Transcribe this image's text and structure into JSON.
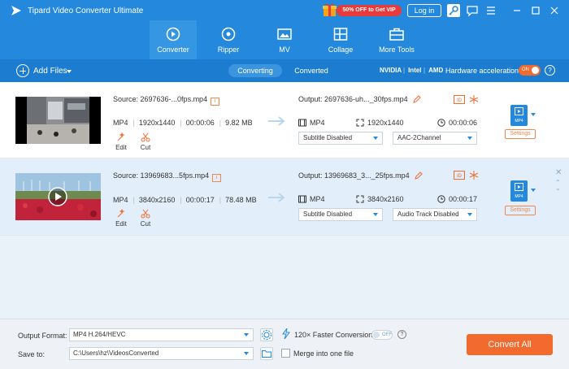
{
  "app": {
    "title": "Tipard Video Converter Ultimate",
    "promo": "50% OFF to Get VIP",
    "login": "Log in"
  },
  "tabs": [
    {
      "label": "Converter",
      "icon": "converter-icon",
      "active": true
    },
    {
      "label": "Ripper",
      "icon": "ripper-icon"
    },
    {
      "label": "MV",
      "icon": "mv-icon"
    },
    {
      "label": "Collage",
      "icon": "collage-icon"
    },
    {
      "label": "More Tools",
      "icon": "toolbox-icon"
    }
  ],
  "subbar": {
    "add_files": "Add Files",
    "seg_converting": "Converting",
    "seg_converted": "Converted",
    "nvidia": "NVIDIA",
    "intel": "Intel",
    "amd": "AMD",
    "hw_label": "Hardware acceleration",
    "hw_toggle": "ON"
  },
  "files": [
    {
      "source": "Source: 2697636-...0fps.mp4",
      "format": "MP4",
      "resolution": "1920x1440",
      "duration": "00:00:06",
      "size": "9.82 MB",
      "edit": "Edit",
      "cut": "Cut",
      "output": "Output: 2697636-uh..._30fps.mp4",
      "out_format": "MP4",
      "out_resolution": "1920x1440",
      "out_duration": "00:00:06",
      "subtitle": "Subtitle Disabled",
      "audio": "AAC-2Channel",
      "settings": "Settings",
      "format_badge": "MP4"
    },
    {
      "source": "Source: 13969683...5fps.mp4",
      "format": "MP4",
      "resolution": "3840x2160",
      "duration": "00:00:17",
      "size": "78.48 MB",
      "edit": "Edit",
      "cut": "Cut",
      "output": "Output: 13969683_3..._25fps.mp4",
      "out_format": "MP4",
      "out_resolution": "3840x2160",
      "out_duration": "00:00:17",
      "subtitle": "Subtitle Disabled",
      "audio": "Audio Track Disabled",
      "settings": "Settings",
      "format_badge": "MP4"
    }
  ],
  "footer": {
    "output_format_label": "Output Format:",
    "output_format_value": "MP4 H.264/HEVC",
    "save_to_label": "Save to:",
    "save_to_value": "C:\\Users\\hz\\VideosConverted",
    "faster": "120× Faster Conversion",
    "faster_toggle": "OFF",
    "merge": "Merge into one file",
    "convert_all": "Convert All"
  },
  "colors": {
    "brand_blue": "#2489dc",
    "accent_orange": "#f26a2e",
    "promo_red": "#e73b3b"
  }
}
